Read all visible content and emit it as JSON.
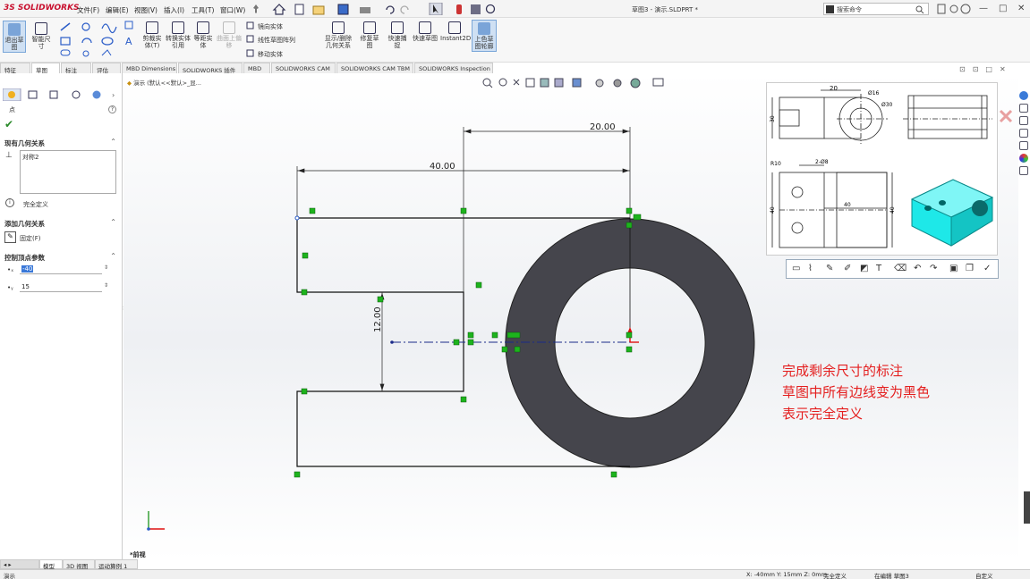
{
  "app": {
    "logo": "3S SOLIDWORKS",
    "document_title": "草图3 - 演示.SLDPRT *",
    "search_placeholder": "搜索命令"
  },
  "menu": [
    "文件(F)",
    "编辑(E)",
    "视图(V)",
    "插入(I)",
    "工具(T)",
    "窗口(W)"
  ],
  "ribbon": {
    "exit_sketch": "退出草图",
    "smart_dim": "智能尺寸",
    "trim": "剪裁实体(T)",
    "convert": "转换实体引用",
    "offset": "等距实体",
    "surface_offset": "曲面上偏移",
    "mirror": "镜向实体",
    "linear_pattern": "线性草图阵列",
    "move": "移动实体",
    "display_relations": "显示/删除几何关系",
    "repair": "修复草图",
    "quick_snap": "快速捕捉",
    "rapid_sketch": "快速草图",
    "instant2d": "Instant2D",
    "shaded_sketch": "上色草图轮廓"
  },
  "tabs": [
    "特征",
    "草图",
    "标注",
    "评估",
    "MBD Dimensions",
    "SOLIDWORKS 插件",
    "MBD",
    "SOLIDWORKS CAM",
    "SOLIDWORKS CAM TBM",
    "SOLIDWORKS Inspection"
  ],
  "left_panel": {
    "point_title": "点",
    "existing_relations_title": "现有几何关系",
    "relation_item": "对称2",
    "fully_defined": "完全定义",
    "add_relations_title": "添加几何关系",
    "fix_label": "固定(F)",
    "params_title": "控制顶点参数",
    "x_value": "-40",
    "y_value": "15"
  },
  "breadcrumb": "演示 (默认<<默认>_显...",
  "dimensions": {
    "d1": "20.00",
    "d2": "40.00",
    "d3": "12.00"
  },
  "reference": {
    "dim_20": "20",
    "dim_phi16": "Ø16",
    "dim_phi30": "Ø30",
    "dim_30": "30",
    "dim_r10": "R10",
    "dim_2phi8": "2-Ø8",
    "dim_40a": "40",
    "dim_40b": "40",
    "dim_40c": "40"
  },
  "annotation": [
    "完成剩余尺寸的标注",
    "草图中所有边线变为黑色",
    "表示完全定义"
  ],
  "view_label": "*前视",
  "model_tabs": [
    "模型",
    "3D 视图",
    "运动算例 1"
  ],
  "status": {
    "left": "演示",
    "coords": "X: -40mm Y: 15mm Z: 0mm",
    "defined": "完全定义",
    "editing": "在编辑 草图3",
    "units": "自定义"
  },
  "colors": {
    "ring": "#45454c",
    "relation_green": "#1db31d",
    "annotation_red": "#e41f1f",
    "part_cyan": "#1ee8e8"
  }
}
